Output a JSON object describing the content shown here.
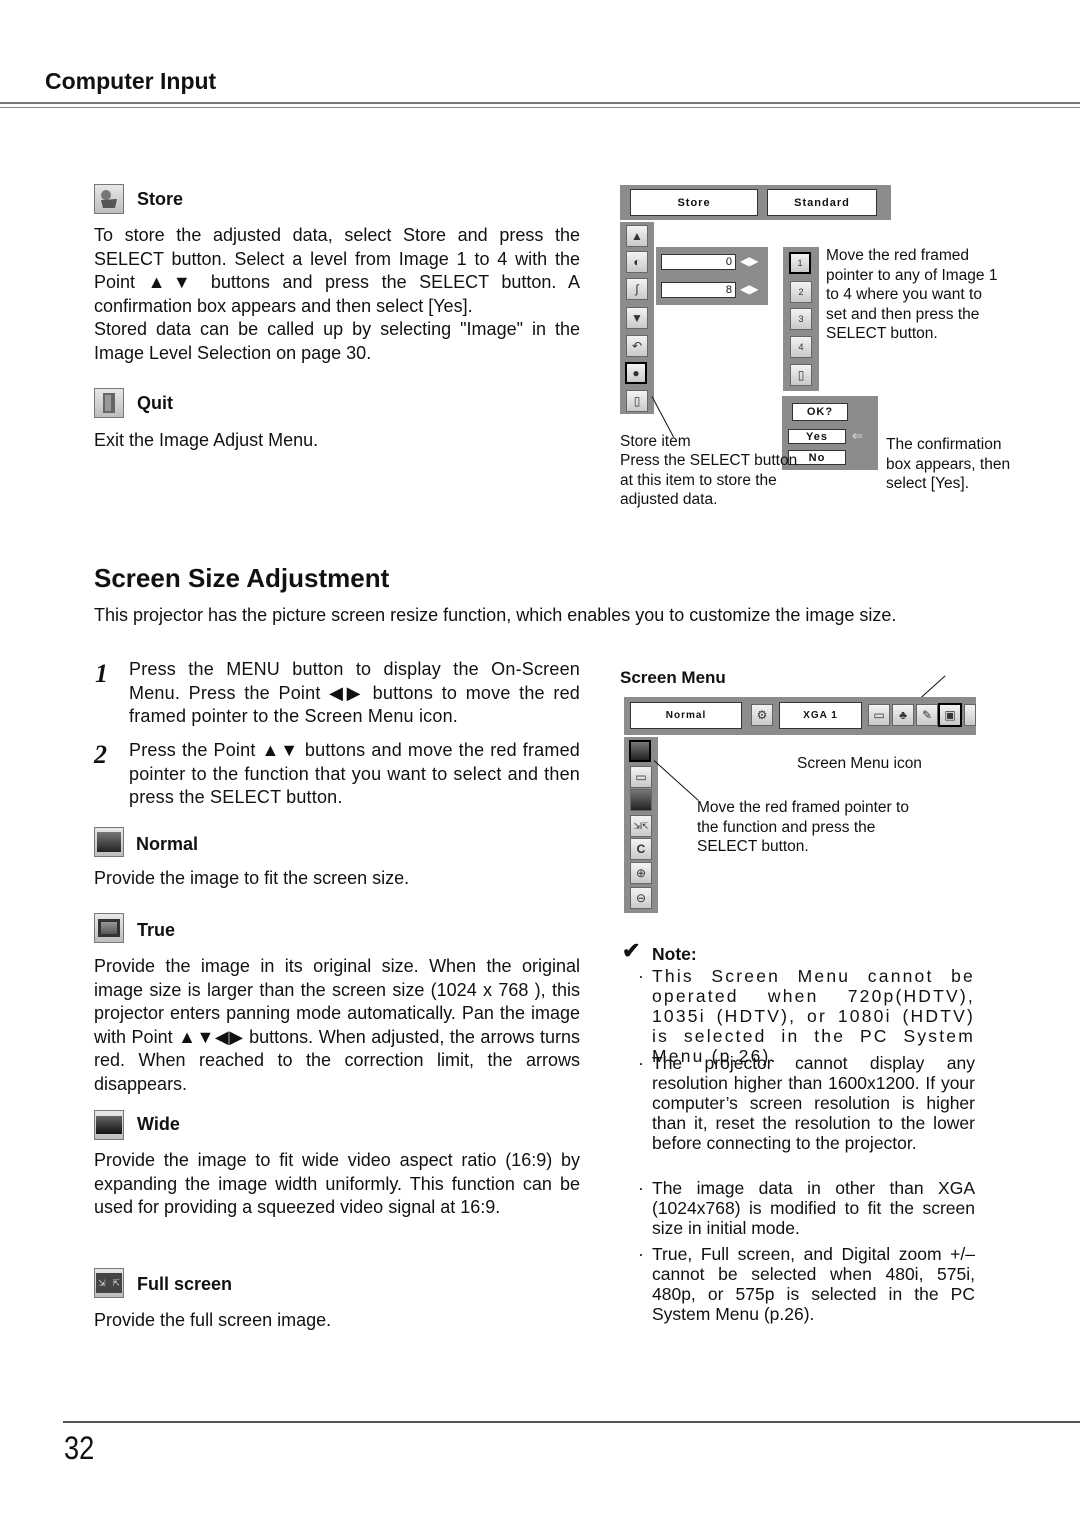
{
  "header": {
    "title": "Computer Input"
  },
  "store": {
    "icon": "store-icon",
    "heading": "Store",
    "body_1": "To store the adjusted data, select Store and press the SELECT button.  Select a level from Image 1 to 4 with the Point ▲▼ buttons and press the SELECT button.  A confirmation box appears and then select [Yes].",
    "body_2": "Stored data can be called up by selecting \"Image\" in the Image Level Selection on page 30."
  },
  "quit": {
    "icon": "quit-door-icon",
    "heading": "Quit",
    "body": "Exit the Image Adjust Menu."
  },
  "store_osd": {
    "top_left": "Store",
    "top_right": "Standard",
    "slider_values": [
      "0",
      "8"
    ],
    "image_slots": [
      "1",
      "2",
      "3",
      "4"
    ],
    "callout_image": "Move the red framed pointer to any of Image 1 to 4 where you want to set and then press the SELECT button.",
    "confirm_title": "OK?",
    "confirm_yes": "Yes",
    "confirm_no": "No",
    "callout_store_item": "Store item",
    "callout_store_desc": "Press the SELECT button at this item to store the adjusted data.",
    "callout_confirm": "The confirmation box appears, then select [Yes]."
  },
  "section": {
    "title": "Screen Size Adjustment",
    "intro": "This projector has the picture screen resize function, which enables you to customize the image size."
  },
  "steps": [
    {
      "num": "1",
      "text": "Press the MENU button to display the On-Screen Menu.  Press the Point ◀▶ buttons to move the red framed pointer to the Screen Menu icon."
    },
    {
      "num": "2",
      "text": "Press the Point ▲▼ buttons and move the red framed pointer to the function that you want to select and then press the SELECT button."
    }
  ],
  "functions": [
    {
      "icon": "normal-screen-icon",
      "heading": "Normal",
      "body": "Provide the image to fit the screen size."
    },
    {
      "icon": "true-screen-icon",
      "heading": "True",
      "body": "Provide the image in its original size. When the original image size is larger than the screen size (1024 x 768 ), this projector enters panning mode automatically. Pan the image with Point ▲▼◀▶ buttons.  When adjusted, the arrows turns red.  When reached to the correction limit, the arrows disappears."
    },
    {
      "icon": "wide-screen-icon",
      "heading": "Wide",
      "body": "Provide the image to fit wide video aspect ratio (16:9) by expanding the image width uniformly.  This function can be used for providing a squeezed video signal at 16:9."
    },
    {
      "icon": "full-screen-icon",
      "heading": "Full screen",
      "body": "Provide the full screen image."
    }
  ],
  "screen_menu": {
    "heading": "Screen Menu",
    "osd_left": "Normal",
    "osd_mid": "XGA 1",
    "callout_icon": "Screen Menu icon",
    "callout_pointer": "Move the red framed pointer to the function and press the SELECT button."
  },
  "note": {
    "heading": "Note:",
    "items": [
      "This Screen Menu cannot be operated when 720p(HDTV), 1035i (HDTV), or 1080i (HDTV) is selected in the PC System Menu (p.26).",
      "The projector cannot display any resolution higher than 1600x1200. If your computer’s screen resolution is higher than it, reset the resolution to the lower before connecting to the projector.",
      "The image data in other than XGA (1024x768) is modified to fit the screen size in initial mode.",
      "True, Full screen, and Digital zoom +/– cannot be selected when 480i, 575i, 480p, or 575p is selected in the PC System Menu (p.26)."
    ]
  },
  "footer": {
    "page_number": "32"
  }
}
